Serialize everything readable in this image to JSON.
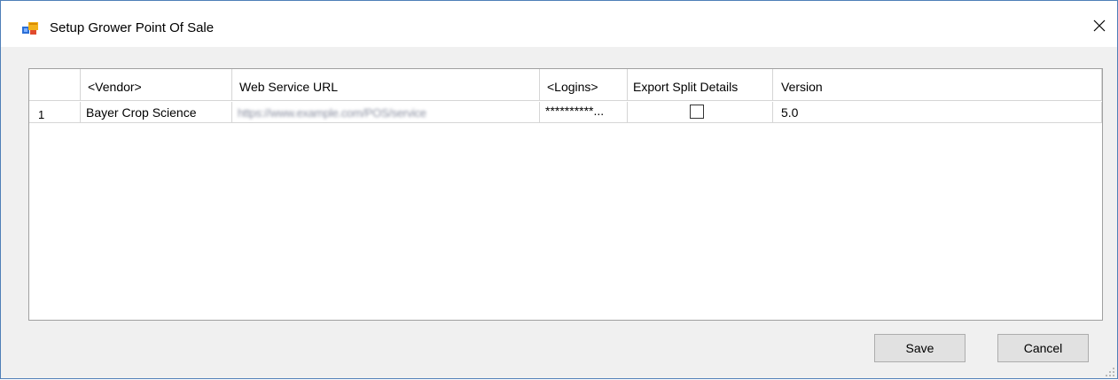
{
  "window": {
    "title": "Setup Grower Point Of Sale",
    "close_glyph": "✕"
  },
  "grid": {
    "columns": [
      "",
      "<Vendor>",
      "Web Service URL",
      "<Logins>",
      "Export Split Details",
      "Version"
    ],
    "rows": [
      {
        "row_header": "1",
        "vendor": "Bayer Crop Science",
        "web_service_url": "https://www.example.com/POS/service",
        "logins": "**********...",
        "export_split_details": false,
        "version": "5.0"
      }
    ]
  },
  "buttons": {
    "save": "Save",
    "cancel": "Cancel"
  }
}
